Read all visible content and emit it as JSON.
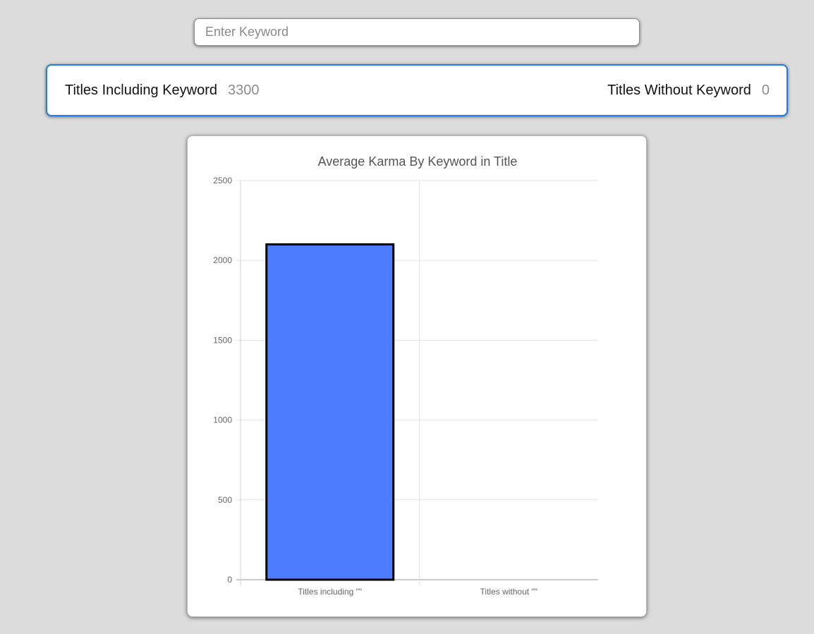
{
  "search": {
    "placeholder": "Enter Keyword",
    "value": ""
  },
  "stats": {
    "including_label": "Titles Including Keyword",
    "including_value": "3300",
    "without_label": "Titles Without Keyword",
    "without_value": "0"
  },
  "colors": {
    "accent_border": "#1e7ee8",
    "bar_fill": "#4d7cfe",
    "bar_border": "#000000"
  },
  "chart_data": {
    "type": "bar",
    "title": "Average Karma By Keyword in Title",
    "categories": [
      "Titles including \"\"",
      "Titles without \"\""
    ],
    "values": [
      2100,
      0
    ],
    "ylim": [
      0,
      2500
    ],
    "yticks": [
      0,
      500,
      1000,
      1500,
      2000,
      2500
    ],
    "grid": true,
    "legend": "none"
  }
}
